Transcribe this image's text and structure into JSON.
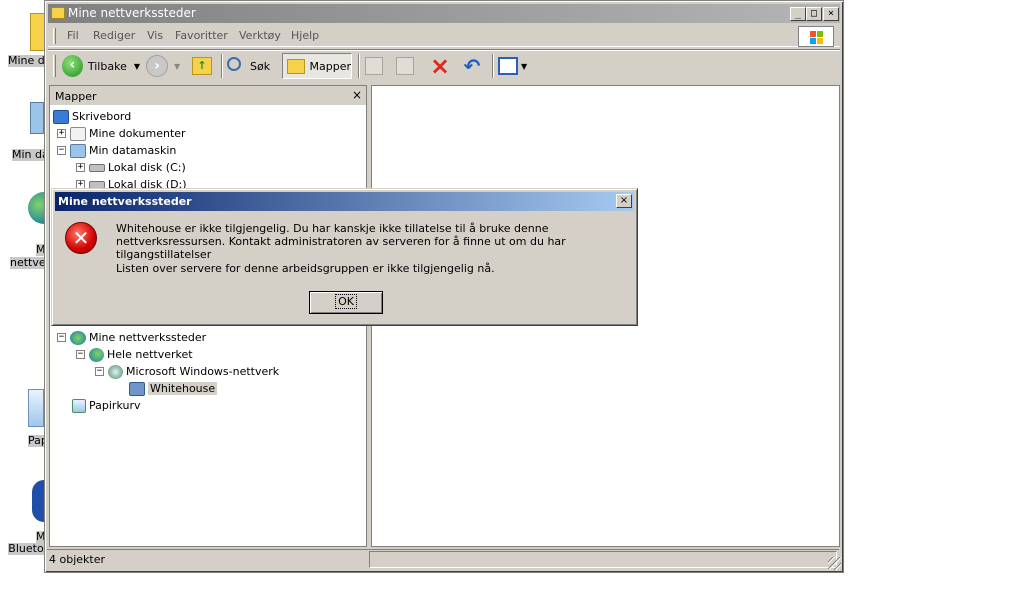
{
  "desktop": {
    "icons": [
      {
        "label": "Mine do"
      },
      {
        "label": "Min da"
      },
      {
        "label": "M",
        "label2": "nettve"
      },
      {
        "label": "Pap"
      },
      {
        "label": "M",
        "label2": "Blueto"
      }
    ]
  },
  "window": {
    "title": "Mine nettverkssteder",
    "controls": {
      "minimize": "_",
      "maximize": "□",
      "close": "×"
    },
    "menu": [
      "Fil",
      "Rediger",
      "Vis",
      "Favoritter",
      "Verktøy",
      "Hjelp"
    ],
    "toolbar": {
      "back": "Tilbake",
      "search": "Søk",
      "folders": "Mapper"
    },
    "folders_pane": {
      "title": "Mapper",
      "close": "×",
      "tree": [
        {
          "label": "Skrivebord",
          "expander": ""
        },
        {
          "label": "Mine dokumenter",
          "expander": "+"
        },
        {
          "label": "Min datamaskin",
          "expander": "−"
        },
        {
          "label": "Lokal disk (C:)",
          "expander": "+"
        },
        {
          "label": "Lokal disk (D:)",
          "expander": "+"
        },
        {
          "label": "Mine nettverkssteder",
          "expander": "−"
        },
        {
          "label": "Hele nettverket",
          "expander": "−"
        },
        {
          "label": "Microsoft Windows-nettverk",
          "expander": "−"
        },
        {
          "label": "Whitehouse",
          "expander": ""
        },
        {
          "label": "Papirkurv",
          "expander": ""
        }
      ]
    },
    "status": "4 objekter"
  },
  "dialog": {
    "title": "Mine nettverkssteder",
    "close": "×",
    "icon_symbol": "✕",
    "message_line1": "Whitehouse er ikke tilgjengelig. Du har kanskje ikke tillatelse til å bruke denne nettverksressursen. Kontakt administratoren av serveren for å finne ut om du har tilgangstillatelser",
    "message_line2": "Listen over servere for denne arbeidsgruppen er ikke tilgjengelig nå.",
    "ok": "OK"
  },
  "colors": {
    "dialog_title_start": "#0a246a",
    "dialog_title_end": "#a6caf0",
    "inactive_title_start": "#808080",
    "window_face": "#d4d0c8",
    "error_red": "#d40000"
  }
}
